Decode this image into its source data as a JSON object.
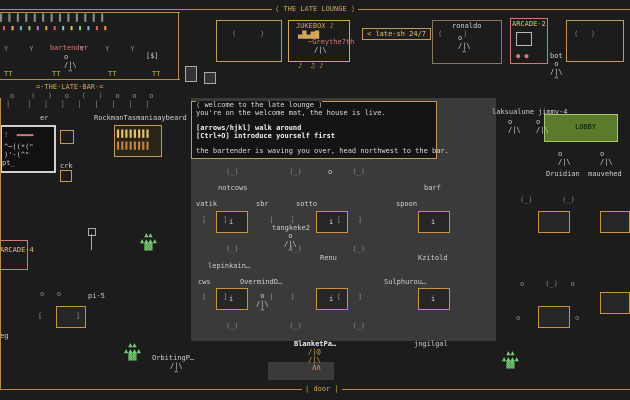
{
  "title": "THE LATE LOUNGE",
  "bar_sign": "=·THE·LATE·BAR·=",
  "jukebox": {
    "label": "JUKEBOX ♪",
    "player": "~Greythe7th"
  },
  "session_button": "late-sh 24/7",
  "arcade_labels": {
    "left": "ARCADE-2",
    "right": "ARCADE-4"
  },
  "lobby_label": "LOBBY",
  "door_label": "door",
  "chat": {
    "title": "welcome to the late lounge",
    "lines": [
      "you're on the welcome mat, the house is live.",
      "",
      "[arrows/hjkl] walk around",
      "[Ctrl+O] introduce yourself first",
      "",
      "the bartender is waving you over, head northwest to the bar."
    ]
  },
  "bartender": "bartender",
  "bar_price": "[$]",
  "bar_tt": [
    "TT",
    "TT",
    "TT",
    "TT"
  ],
  "bookshelf_label": "RockmanTasmaniaaybeard",
  "avatars": [
    {
      "name": "ronaldo"
    },
    {
      "name": "bot"
    },
    {
      "name": "er"
    },
    {
      "name": "crk"
    },
    {
      "name": "pt_"
    },
    {
      "name": "notcows"
    },
    {
      "name": "vatik"
    },
    {
      "name": "sbr"
    },
    {
      "name": "sotto"
    },
    {
      "name": "barf"
    },
    {
      "name": "spoon"
    },
    {
      "name": "tangkeke2"
    },
    {
      "name": "Renu"
    },
    {
      "name": "Kzitold"
    },
    {
      "name": "lepinkain…"
    },
    {
      "name": "cws"
    },
    {
      "name": "OvermindD…"
    },
    {
      "name": "Sulphurou…"
    },
    {
      "name": "pi-5"
    },
    {
      "name": "BlanketPa…"
    },
    {
      "name": "jngilgal"
    },
    {
      "name": "OrbitingP…"
    },
    {
      "name": "laksualune"
    },
    {
      "name": "jimmy-4"
    },
    {
      "name": "Druidian"
    },
    {
      "name": "mauvehed"
    },
    {
      "name": "eg"
    }
  ],
  "figure": {
    "head": "o",
    "body": "/|\\",
    "legs": "/\\"
  },
  "colors": {
    "accent": "#d4a55a",
    "lobby": "#5a7a2c",
    "arcade": "#d27a7a",
    "plant": "#77d074",
    "hall": "#3a3a3a"
  }
}
